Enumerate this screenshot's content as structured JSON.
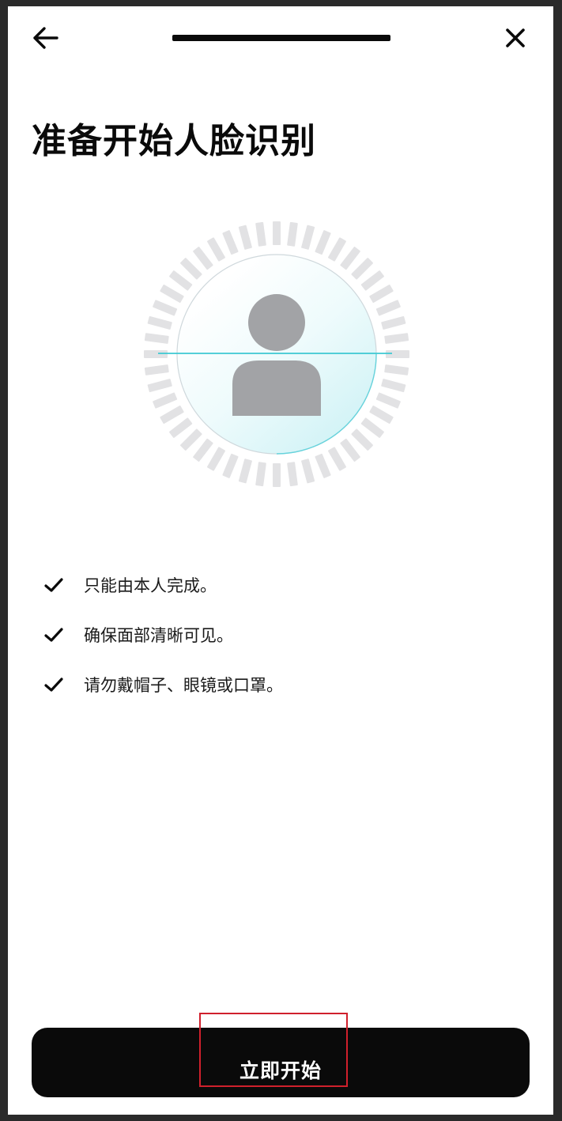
{
  "header": {
    "back_icon": "arrow-left-icon",
    "close_icon": "close-icon"
  },
  "title": "准备开始人脸识别",
  "face_graphic": {
    "icon": "person-silhouette-icon",
    "scan_line_color": "#3cc8d2",
    "dash_color": "#e2e2e4",
    "silhouette_color": "#a2a3a6"
  },
  "checklist": [
    {
      "icon": "checkmark-icon",
      "text": "只能由本人完成。"
    },
    {
      "icon": "checkmark-icon",
      "text": "确保面部清晰可见。"
    },
    {
      "icon": "checkmark-icon",
      "text": "请勿戴帽子、眼镜或口罩。"
    }
  ],
  "start_button": {
    "label": "立即开始",
    "background": "#0a0a0a",
    "highlight_color": "#d0202c"
  }
}
